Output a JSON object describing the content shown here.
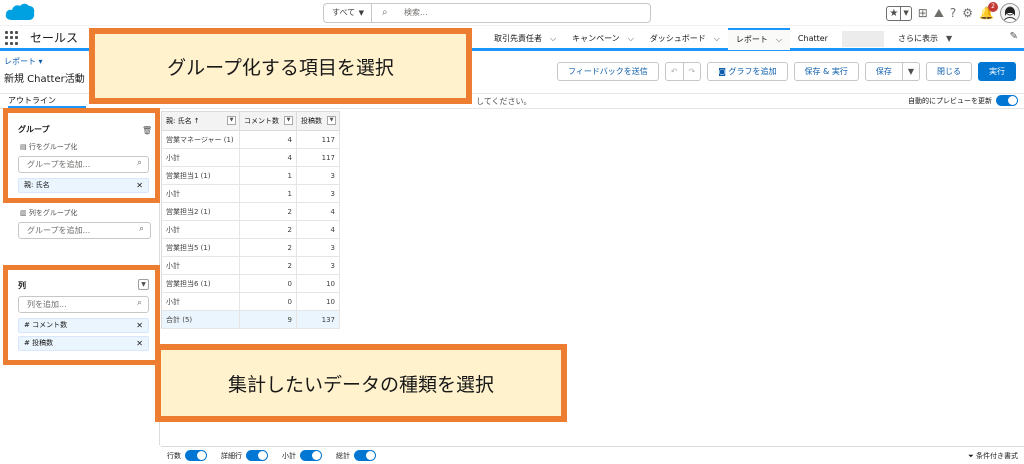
{
  "topbar": {
    "search_scope": "すべて",
    "search_placeholder": "検索...",
    "notification_count": "2"
  },
  "nav": {
    "app_name": "セールス",
    "tabs": [
      {
        "label": "取引先責任者"
      },
      {
        "label": "キャンペーン"
      },
      {
        "label": "ダッシュボード"
      },
      {
        "label": "レポート"
      },
      {
        "label": "Chatter"
      },
      {
        "label": "さらに表示"
      }
    ]
  },
  "report": {
    "breadcrumb": "レポート ▾",
    "title": "新規 Chatter活動 レ",
    "buttons": {
      "feedback": "フィードバックを送信",
      "add_chart": "グラフを追加",
      "save_run": "保存 & 実行",
      "save": "保存",
      "close": "閉じる",
      "run": "実行"
    },
    "info_message": "してください。",
    "auto_preview_label": "自動的にプレビューを更新"
  },
  "outline": {
    "tab_label": "アウトライン",
    "groups_title": "グループ",
    "group_rows_label": "行をグループ化",
    "group_rows_placeholder": "グループを追加...",
    "group_row_pill": "親: 氏名",
    "group_cols_label": "列をグループ化",
    "group_cols_placeholder": "グループを追加...",
    "columns_title": "列",
    "columns_placeholder": "列を追加...",
    "column_pills": [
      "# コメント数",
      "# 投稿数"
    ]
  },
  "table": {
    "headers": [
      "親: 氏名 ↑",
      "コメント数",
      "投稿数"
    ],
    "rows": [
      {
        "name": "営業マネージャー (1)",
        "comments": "4",
        "posts": "117",
        "kind": "group"
      },
      {
        "name": "小計",
        "comments": "4",
        "posts": "117",
        "kind": "subtotal"
      },
      {
        "name": "営業担当1 (1)",
        "comments": "1",
        "posts": "3",
        "kind": "group"
      },
      {
        "name": "小計",
        "comments": "1",
        "posts": "3",
        "kind": "subtotal"
      },
      {
        "name": "営業担当2 (1)",
        "comments": "2",
        "posts": "4",
        "kind": "group"
      },
      {
        "name": "小計",
        "comments": "2",
        "posts": "4",
        "kind": "subtotal"
      },
      {
        "name": "営業担当5 (1)",
        "comments": "2",
        "posts": "3",
        "kind": "group"
      },
      {
        "name": "小計",
        "comments": "2",
        "posts": "3",
        "kind": "subtotal"
      },
      {
        "name": "営業担当6 (1)",
        "comments": "0",
        "posts": "10",
        "kind": "group"
      },
      {
        "name": "小計",
        "comments": "0",
        "posts": "10",
        "kind": "subtotal"
      },
      {
        "name": "合計 (5)",
        "comments": "9",
        "posts": "137",
        "kind": "grand"
      }
    ]
  },
  "footer": {
    "toggles": [
      {
        "label": "行数"
      },
      {
        "label": "詳細行"
      },
      {
        "label": "小計"
      },
      {
        "label": "総計"
      }
    ],
    "conditional_format": "条件付き書式"
  },
  "annotations": {
    "callout_group": "グループ化する項目を選択",
    "callout_aggregate": "集計したいデータの種類を選択",
    "accent_color": "#ed7d31",
    "callout_fill": "#fff2cc"
  }
}
